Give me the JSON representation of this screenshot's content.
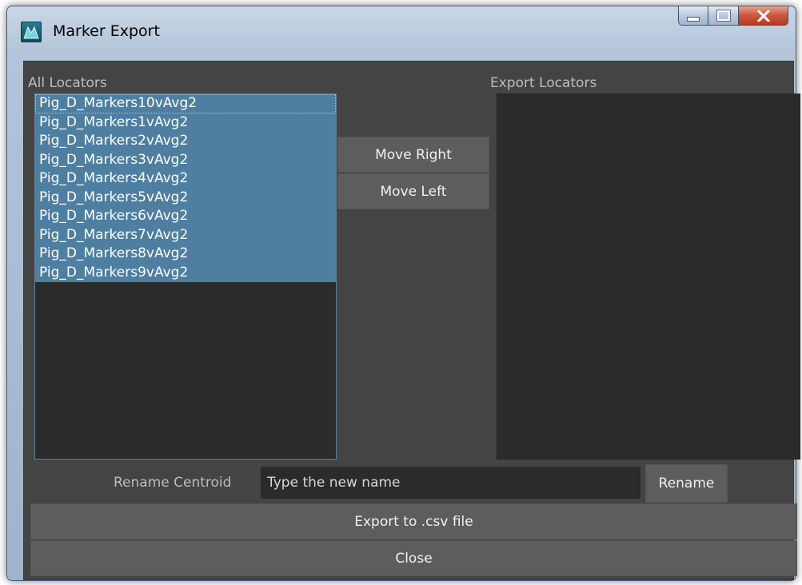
{
  "window": {
    "title": "Marker Export",
    "icon": "maya-app-icon",
    "controls": [
      "minimize-icon",
      "maximize-icon",
      "close-icon"
    ]
  },
  "all_locators": {
    "label": "All Locators",
    "items": [
      "Pig_D_Markers10vAvg2",
      "Pig_D_Markers1vAvg2",
      "Pig_D_Markers2vAvg2",
      "Pig_D_Markers3vAvg2",
      "Pig_D_Markers4vAvg2",
      "Pig_D_Markers5vAvg2",
      "Pig_D_Markers6vAvg2",
      "Pig_D_Markers7vAvg2",
      "Pig_D_Markers8vAvg2",
      "Pig_D_Markers9vAvg2"
    ]
  },
  "export_locators": {
    "label": "Export Locators",
    "items": []
  },
  "buttons": {
    "move_right": "Move Right",
    "move_left": "Move Left",
    "rename": "Rename",
    "export": "Export to .csv file",
    "close": "Close"
  },
  "rename": {
    "label": "Rename Centroid",
    "placeholder": "Type the new name"
  },
  "colors": {
    "client_bg": "#444444",
    "list_bg": "#2b2b2b",
    "selection": "#4e7fa1",
    "button_bg": "#5d5d5d"
  }
}
